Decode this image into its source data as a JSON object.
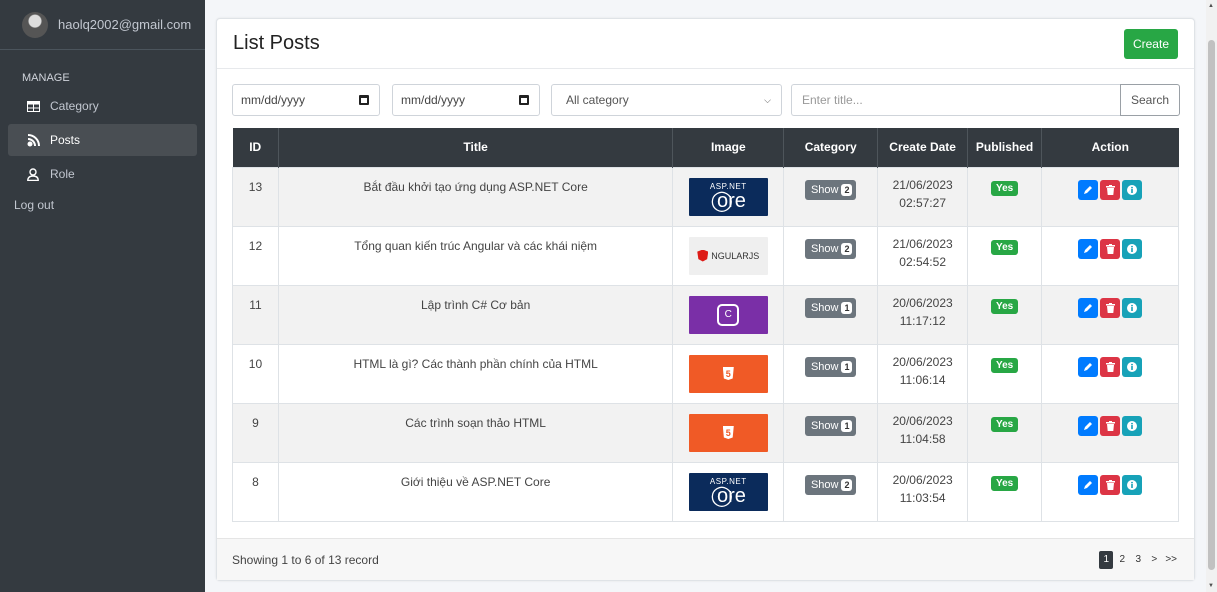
{
  "sidebar": {
    "user_email": "haolq2002@gmail.com",
    "section_label": "MANAGE",
    "items": [
      {
        "label": "Category",
        "icon": "table-icon"
      },
      {
        "label": "Posts",
        "icon": "blog-icon"
      },
      {
        "label": "Role",
        "icon": "user-icon"
      }
    ],
    "logout_label": "Log out"
  },
  "header": {
    "title": "List Posts",
    "create_label": "Create"
  },
  "filters": {
    "date_from_placeholder": "mm/dd/yyyy",
    "date_to_placeholder": "mm/dd/yyyy",
    "category_selected": "All category",
    "title_placeholder": "Enter title...",
    "search_label": "Search"
  },
  "table": {
    "columns": [
      "ID",
      "Title",
      "Image",
      "Category",
      "Create Date",
      "Published",
      "Action"
    ],
    "rows": [
      {
        "id": "13",
        "title": "Bắt đầu khởi tạo ứng dụng ASP.NET Core",
        "image": "aspnet-core-logo",
        "show_label": "Show",
        "category_count": "2",
        "date": "21/06/2023",
        "time": "02:57:27",
        "published": "Yes"
      },
      {
        "id": "12",
        "title": "Tổng quan kiến trúc Angular và các khái niệm",
        "image": "angularjs-logo",
        "show_label": "Show",
        "category_count": "2",
        "date": "21/06/2023",
        "time": "02:54:52",
        "published": "Yes"
      },
      {
        "id": "11",
        "title": "Lập trình C# Cơ bản",
        "image": "csharp-logo",
        "show_label": "Show",
        "category_count": "1",
        "date": "20/06/2023",
        "time": "11:17:12",
        "published": "Yes"
      },
      {
        "id": "10",
        "title": "HTML là gì? Các thành phần chính của HTML",
        "image": "html5-logo",
        "show_label": "Show",
        "category_count": "1",
        "date": "20/06/2023",
        "time": "11:06:14",
        "published": "Yes"
      },
      {
        "id": "9",
        "title": "Các trình soạn thảo HTML",
        "image": "html5-logo",
        "show_label": "Show",
        "category_count": "1",
        "date": "20/06/2023",
        "time": "11:04:58",
        "published": "Yes"
      },
      {
        "id": "8",
        "title": "Giới thiệu về ASP.NET Core",
        "image": "aspnet-core-logo",
        "show_label": "Show",
        "category_count": "2",
        "date": "20/06/2023",
        "time": "11:03:54",
        "published": "Yes"
      }
    ]
  },
  "footer": {
    "showing": "Showing 1 to 6 of 13 record",
    "pages": [
      "1",
      "2",
      "3",
      ">",
      ">>"
    ],
    "active_page": "1"
  },
  "logos": {
    "aspnet_small": "ASP.NET",
    "aspnet_big": "ore",
    "angular": "NGULARJS",
    "csharp": "C",
    "html": "5"
  },
  "colors": {
    "sidebar_bg": "#343a40",
    "primary": "#007bff",
    "success": "#28a745",
    "danger": "#dc3545",
    "info": "#17a2b8"
  }
}
